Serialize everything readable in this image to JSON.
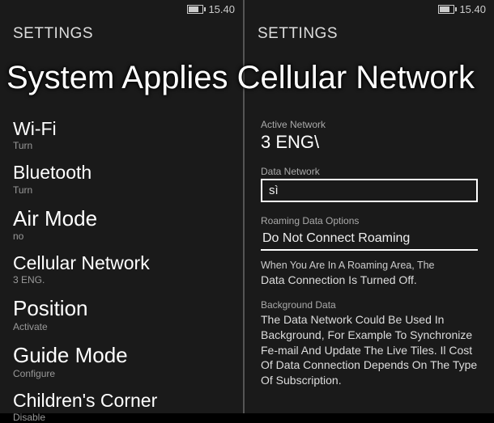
{
  "status": {
    "time": "15.40"
  },
  "left": {
    "header": "SETTINGS",
    "items": [
      {
        "title": "Wi-Fi",
        "sub": "Turn"
      },
      {
        "title": "Bluetooth",
        "sub": "Turn"
      },
      {
        "title": "Air Mode",
        "sub": "no"
      },
      {
        "title": "Cellular Network",
        "sub": "3 ENG."
      },
      {
        "title": "Position",
        "sub": "Activate"
      },
      {
        "title": "Guide Mode",
        "sub": "Configure"
      },
      {
        "title": "Children's Corner",
        "sub": "Disable"
      }
    ]
  },
  "right": {
    "header": "SETTINGS",
    "active_label": "Active Network",
    "active_value": "3 ENG\\",
    "datanet_label": "Data Network",
    "datanet_value": "sì",
    "roaming_label": "Roaming Data Options",
    "roaming_value": "Do Not Connect Roaming",
    "roaming_expl1": "When You Are In A Roaming Area, The",
    "roaming_expl2": "Data Connection Is Turned Off.",
    "bg_label": "Background Data",
    "bg_expl": "The Data Network Could Be Used In Background, For Example To Synchronize Fe-mail And Update The Live Tiles. Il Cost Of Data Connection Depends On The Type Of Subscription."
  },
  "overlay": {
    "text": "System Applies Cellular Network"
  }
}
